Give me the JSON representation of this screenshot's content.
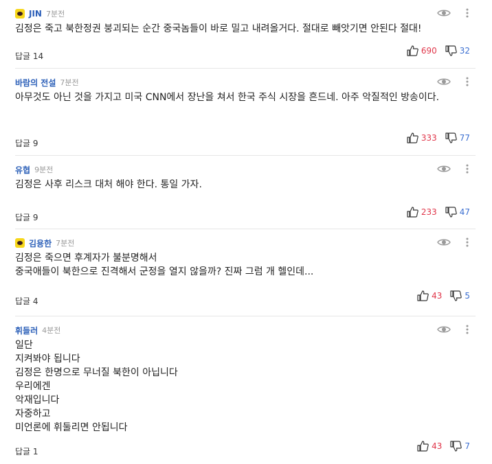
{
  "comments": [
    {
      "author": "JIN",
      "kakao": true,
      "time": "7분전",
      "text": "김정은 죽고 북한정권 붕괴되는 순간 중국놈들이 바로 밀고 내려올거다. 절대로 빼앗기면 안된다 절대!",
      "reply_label": "답글",
      "reply_count": "14",
      "likes": "690",
      "dislikes": "32"
    },
    {
      "author": "바람의 전설",
      "kakao": false,
      "time": "7분전",
      "text": "아무것도 아닌 것을 가지고 미국 CNN에서 장난을 쳐서 한국 주식 시장을 흔드네. 아주 악질적인 방송이다.",
      "reply_label": "답글",
      "reply_count": "9",
      "likes": "333",
      "dislikes": "77"
    },
    {
      "author": "유협",
      "kakao": false,
      "time": "9분전",
      "text": "김정은 사후 리스크 대처 해야 한다. 통일 가자.",
      "reply_label": "답글",
      "reply_count": "9",
      "likes": "233",
      "dislikes": "47"
    },
    {
      "author": "김용한",
      "kakao": true,
      "time": "7분전",
      "text": "김정은 죽으면 후계자가 불분명해서\n중국애들이 북한으로 진격해서 군정을 열지 않을까? 진짜 그럼 개 헬인데...",
      "reply_label": "답글",
      "reply_count": "4",
      "likes": "43",
      "dislikes": "5"
    },
    {
      "author": "휘들러",
      "kakao": false,
      "time": "4분전",
      "text": "일단\n지켜봐야 됩니다\n김정은 한명으로 무너질 북한이 아닙니다\n우리에겐\n악재입니다\n자중하고\n미언론에 휘둘리면 안됩니다",
      "reply_label": "답글",
      "reply_count": "1",
      "likes": "43",
      "dislikes": "7"
    }
  ]
}
